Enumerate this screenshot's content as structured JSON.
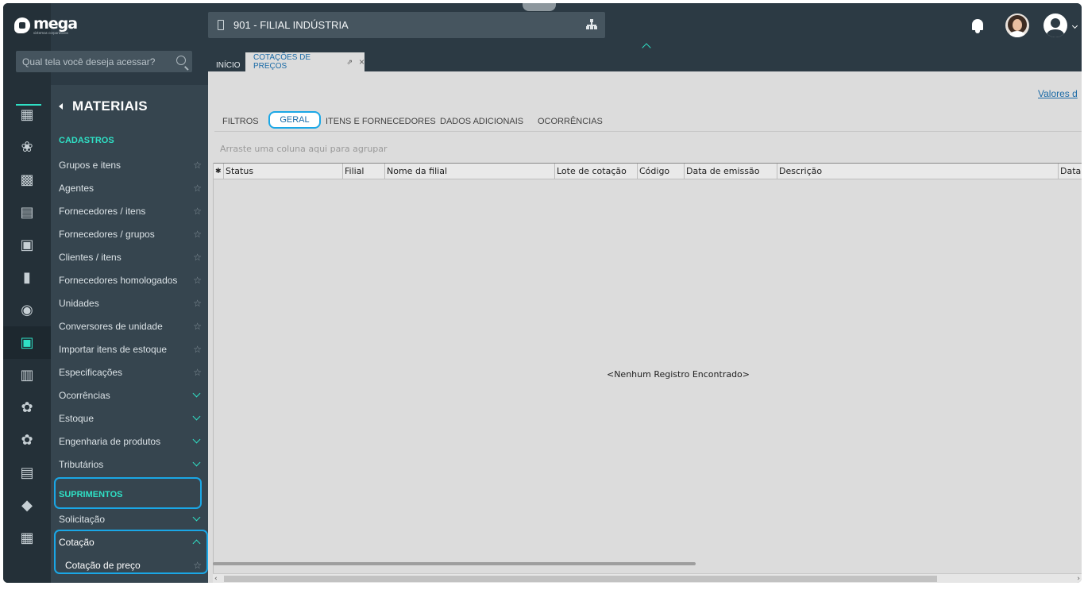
{
  "brand": {
    "name": "mega",
    "tagline": "sistemas corporativos"
  },
  "search": {
    "placeholder": "Qual tela você deseja acessar?"
  },
  "branch": {
    "label": "901 - FILIAL INDÚSTRIA"
  },
  "page_tabs": {
    "home": "INÍCIO",
    "active": "COTAÇÕES DE PREÇOS"
  },
  "menu": {
    "title": "MATERIAIS",
    "section1": "CADASTROS",
    "items": [
      "Grupos e itens",
      "Agentes",
      "Fornecedores / itens",
      "Fornecedores / grupos",
      "Clientes / itens",
      "Fornecedores homologados",
      "Unidades",
      "Conversores de unidade",
      "Importar itens de estoque",
      "Especificações"
    ],
    "groups": [
      "Ocorrências",
      "Estoque",
      "Engenharia de produtos",
      "Tributários"
    ],
    "section2": "SUPRIMENTOS",
    "sup_items": [
      "Solicitação",
      "Cotação"
    ],
    "sub_item": "Cotação de preço"
  },
  "content": {
    "valores_link": "Valores d",
    "subtabs": [
      "FILTROS",
      "GERAL",
      "ITENS E FORNECEDORES",
      "DADOS ADICIONAIS",
      "OCORRÊNCIAS"
    ],
    "group_hint": "Arraste uma coluna aqui para agrupar",
    "columns": [
      "Status",
      "Filial",
      "Nome da filial",
      "Lote de cotação",
      "Código",
      "Data de emissão",
      "Descrição",
      "Data"
    ],
    "empty": "<Nenhum Registro Encontrado>"
  },
  "colors": {
    "accent": "#2fe0c5",
    "highlight": "#1aa7e6",
    "sidebar": "#36454f",
    "topbar": "#2c3a44"
  },
  "icons": [
    "bell-icon",
    "avatar",
    "user-icon",
    "search-icon",
    "hierarchy-icon",
    "star-icon",
    "chevron-down-icon"
  ]
}
